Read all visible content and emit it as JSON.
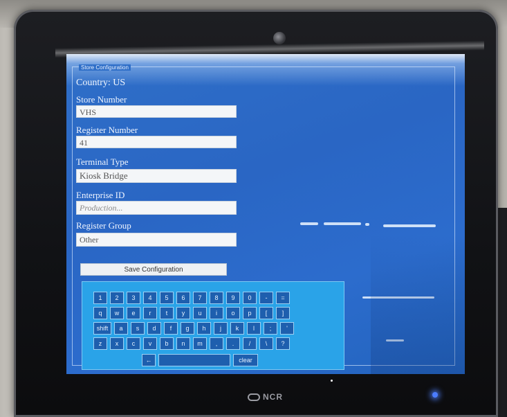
{
  "screen": {
    "group_title": "Store Configuration",
    "country": "Country: US",
    "fields": [
      {
        "label": "Store Number",
        "value": "VHS"
      },
      {
        "label": "Register Number",
        "value": "41"
      },
      {
        "label": "Terminal Type",
        "value": "Kiosk Bridge"
      },
      {
        "label": "Enterprise ID",
        "value": "Production..."
      },
      {
        "label": "Register Group",
        "value": "Other"
      }
    ],
    "save_label": "Save Configuration"
  },
  "keyboard": {
    "row1": [
      "1",
      "2",
      "3",
      "4",
      "5",
      "6",
      "7",
      "8",
      "9",
      "0",
      "-",
      "="
    ],
    "row2": [
      "q",
      "w",
      "e",
      "r",
      "t",
      "y",
      "u",
      "i",
      "o",
      "p",
      "[",
      "]"
    ],
    "row3": [
      "shift",
      "a",
      "s",
      "d",
      "f",
      "g",
      "h",
      "j",
      "k",
      "l",
      ";",
      "'"
    ],
    "row4": [
      "z",
      "x",
      "c",
      "v",
      "b",
      "n",
      "m",
      ",",
      ".",
      "/",
      "\\",
      "?"
    ],
    "row5": [
      "←",
      "",
      "clear"
    ]
  },
  "device": {
    "brand": "NCR",
    "led_color": "#4b7cff",
    "accent_blue": "#2c6ccd"
  }
}
